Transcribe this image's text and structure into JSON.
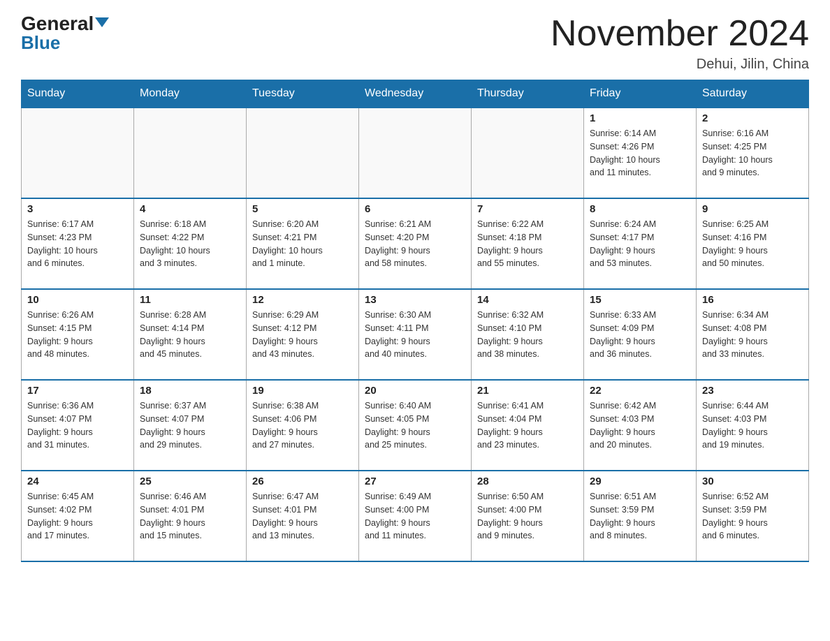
{
  "header": {
    "logo": {
      "general": "General",
      "blue": "Blue"
    },
    "title": "November 2024",
    "location": "Dehui, Jilin, China"
  },
  "days_of_week": [
    "Sunday",
    "Monday",
    "Tuesday",
    "Wednesday",
    "Thursday",
    "Friday",
    "Saturday"
  ],
  "weeks": [
    [
      {
        "day": "",
        "info": ""
      },
      {
        "day": "",
        "info": ""
      },
      {
        "day": "",
        "info": ""
      },
      {
        "day": "",
        "info": ""
      },
      {
        "day": "",
        "info": ""
      },
      {
        "day": "1",
        "info": "Sunrise: 6:14 AM\nSunset: 4:26 PM\nDaylight: 10 hours\nand 11 minutes."
      },
      {
        "day": "2",
        "info": "Sunrise: 6:16 AM\nSunset: 4:25 PM\nDaylight: 10 hours\nand 9 minutes."
      }
    ],
    [
      {
        "day": "3",
        "info": "Sunrise: 6:17 AM\nSunset: 4:23 PM\nDaylight: 10 hours\nand 6 minutes."
      },
      {
        "day": "4",
        "info": "Sunrise: 6:18 AM\nSunset: 4:22 PM\nDaylight: 10 hours\nand 3 minutes."
      },
      {
        "day": "5",
        "info": "Sunrise: 6:20 AM\nSunset: 4:21 PM\nDaylight: 10 hours\nand 1 minute."
      },
      {
        "day": "6",
        "info": "Sunrise: 6:21 AM\nSunset: 4:20 PM\nDaylight: 9 hours\nand 58 minutes."
      },
      {
        "day": "7",
        "info": "Sunrise: 6:22 AM\nSunset: 4:18 PM\nDaylight: 9 hours\nand 55 minutes."
      },
      {
        "day": "8",
        "info": "Sunrise: 6:24 AM\nSunset: 4:17 PM\nDaylight: 9 hours\nand 53 minutes."
      },
      {
        "day": "9",
        "info": "Sunrise: 6:25 AM\nSunset: 4:16 PM\nDaylight: 9 hours\nand 50 minutes."
      }
    ],
    [
      {
        "day": "10",
        "info": "Sunrise: 6:26 AM\nSunset: 4:15 PM\nDaylight: 9 hours\nand 48 minutes."
      },
      {
        "day": "11",
        "info": "Sunrise: 6:28 AM\nSunset: 4:14 PM\nDaylight: 9 hours\nand 45 minutes."
      },
      {
        "day": "12",
        "info": "Sunrise: 6:29 AM\nSunset: 4:12 PM\nDaylight: 9 hours\nand 43 minutes."
      },
      {
        "day": "13",
        "info": "Sunrise: 6:30 AM\nSunset: 4:11 PM\nDaylight: 9 hours\nand 40 minutes."
      },
      {
        "day": "14",
        "info": "Sunrise: 6:32 AM\nSunset: 4:10 PM\nDaylight: 9 hours\nand 38 minutes."
      },
      {
        "day": "15",
        "info": "Sunrise: 6:33 AM\nSunset: 4:09 PM\nDaylight: 9 hours\nand 36 minutes."
      },
      {
        "day": "16",
        "info": "Sunrise: 6:34 AM\nSunset: 4:08 PM\nDaylight: 9 hours\nand 33 minutes."
      }
    ],
    [
      {
        "day": "17",
        "info": "Sunrise: 6:36 AM\nSunset: 4:07 PM\nDaylight: 9 hours\nand 31 minutes."
      },
      {
        "day": "18",
        "info": "Sunrise: 6:37 AM\nSunset: 4:07 PM\nDaylight: 9 hours\nand 29 minutes."
      },
      {
        "day": "19",
        "info": "Sunrise: 6:38 AM\nSunset: 4:06 PM\nDaylight: 9 hours\nand 27 minutes."
      },
      {
        "day": "20",
        "info": "Sunrise: 6:40 AM\nSunset: 4:05 PM\nDaylight: 9 hours\nand 25 minutes."
      },
      {
        "day": "21",
        "info": "Sunrise: 6:41 AM\nSunset: 4:04 PM\nDaylight: 9 hours\nand 23 minutes."
      },
      {
        "day": "22",
        "info": "Sunrise: 6:42 AM\nSunset: 4:03 PM\nDaylight: 9 hours\nand 20 minutes."
      },
      {
        "day": "23",
        "info": "Sunrise: 6:44 AM\nSunset: 4:03 PM\nDaylight: 9 hours\nand 19 minutes."
      }
    ],
    [
      {
        "day": "24",
        "info": "Sunrise: 6:45 AM\nSunset: 4:02 PM\nDaylight: 9 hours\nand 17 minutes."
      },
      {
        "day": "25",
        "info": "Sunrise: 6:46 AM\nSunset: 4:01 PM\nDaylight: 9 hours\nand 15 minutes."
      },
      {
        "day": "26",
        "info": "Sunrise: 6:47 AM\nSunset: 4:01 PM\nDaylight: 9 hours\nand 13 minutes."
      },
      {
        "day": "27",
        "info": "Sunrise: 6:49 AM\nSunset: 4:00 PM\nDaylight: 9 hours\nand 11 minutes."
      },
      {
        "day": "28",
        "info": "Sunrise: 6:50 AM\nSunset: 4:00 PM\nDaylight: 9 hours\nand 9 minutes."
      },
      {
        "day": "29",
        "info": "Sunrise: 6:51 AM\nSunset: 3:59 PM\nDaylight: 9 hours\nand 8 minutes."
      },
      {
        "day": "30",
        "info": "Sunrise: 6:52 AM\nSunset: 3:59 PM\nDaylight: 9 hours\nand 6 minutes."
      }
    ]
  ]
}
